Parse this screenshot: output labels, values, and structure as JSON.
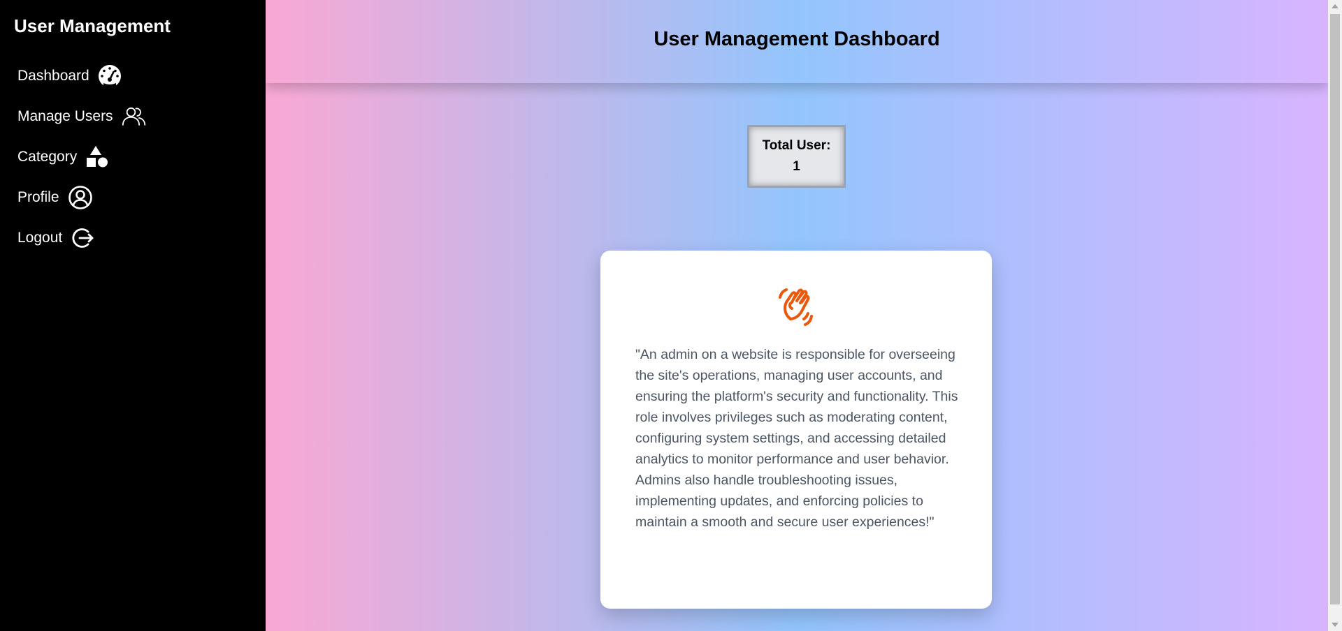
{
  "sidebar": {
    "title": "User Management",
    "items": [
      {
        "label": "Dashboard",
        "icon": "dashboard-gauge-icon"
      },
      {
        "label": "Manage Users",
        "icon": "users-icon"
      },
      {
        "label": "Category",
        "icon": "shapes-icon"
      },
      {
        "label": "Profile",
        "icon": "user-circle-icon"
      },
      {
        "label": "Logout",
        "icon": "logout-icon"
      }
    ]
  },
  "header": {
    "title": "User Management Dashboard"
  },
  "stats": {
    "total_user_label": "Total User:",
    "total_user_value": "1"
  },
  "info_card": {
    "icon": "waving-hand-icon",
    "text": "\"An admin on a website is responsible for overseeing the site's operations, managing user accounts, and ensuring the platform's security and functionality. This role involves privileges such as moderating content, configuring system settings, and accessing detailed analytics to monitor performance and user behavior. Admins also handle troubleshooting issues, implementing updates, and enforcing policies to maintain a smooth and secure user experiences!\""
  },
  "colors": {
    "sidebar_bg": "#000000",
    "gradient_start": "#f9a8d4",
    "gradient_mid": "#93c5fd",
    "gradient_end": "#d8b4fe",
    "accent_orange": "#ea580c"
  }
}
